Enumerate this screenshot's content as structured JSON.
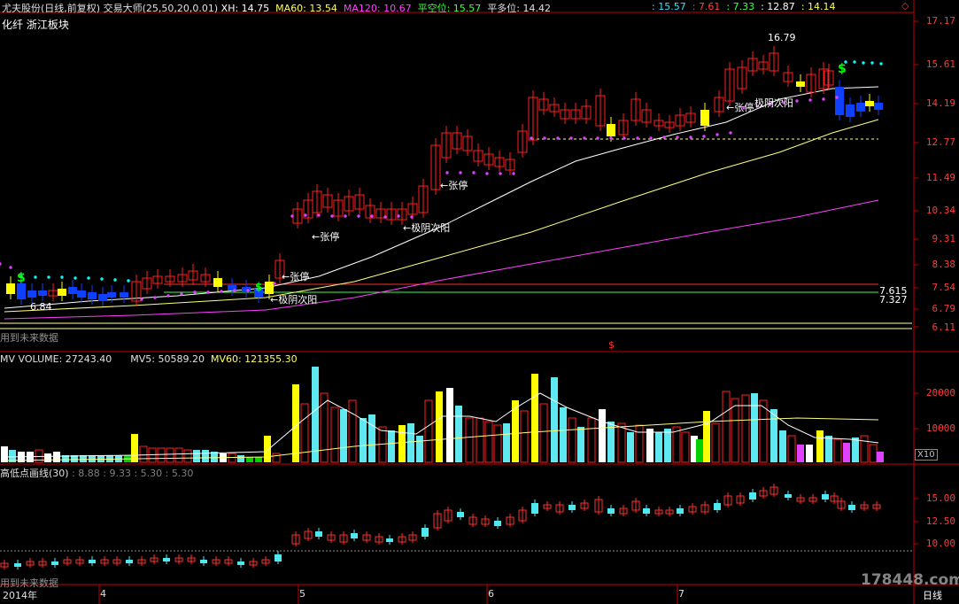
{
  "header": {
    "title": "尤夫股份(日线,前复权)",
    "indicator_name": "交易大师(25,50,20,0.01)",
    "xh": "XH: 14.75",
    "ma60": "MA60: 13.54",
    "ma120": "MA120: 10.67",
    "pingkong": "平空位: 15.57",
    "pingduo": "平多位: 14.42",
    "right_values": [
      ": 15.57",
      ": 7.61",
      ": 7.33",
      ": 12.87",
      ": 14.14"
    ],
    "sector": "化纤 浙江板块"
  },
  "main": {
    "y_labels": [
      "17.17",
      "15.61",
      "14.19",
      "12.77",
      "11.49",
      "10.34",
      "9.31",
      "8.38",
      "7.54",
      "6.79",
      "6.11"
    ],
    "annotations": {
      "high": "16.79",
      "low": "6.84",
      "zt1": "←张停",
      "zt2": "←张停",
      "zt3": "←张停",
      "zt4": "←张停",
      "jy1": "←极阴次阳",
      "jy2": "←极阴次阳",
      "jy3": "极阴次阳",
      "level1": "7.615",
      "level2": "7.327",
      "future": "用到未来数据",
      "dollar": "$"
    }
  },
  "volume": {
    "header": "MV VOLUME: 27243.40",
    "mv5": "MV5: 50589.20",
    "mv60": "MV60: 121355.30",
    "y_labels": [
      "20000",
      "10000"
    ],
    "unit": "X10"
  },
  "hl": {
    "header": "高低点画线(30)",
    "values": ": 8.88 : 9.33 : 5.30 : 5.30",
    "y_labels": [
      "15.00",
      "12.50",
      "10.00"
    ],
    "future": "用到未来数据"
  },
  "dates": [
    "2014年",
    "4",
    "5",
    "6",
    "7"
  ],
  "bottom_right": "日线",
  "watermark": "178448.com",
  "colors": {
    "up": "#ff3030",
    "down": "#50e8f0",
    "cyan": "#00ffff",
    "yellow": "#ffff00",
    "magenta": "#ff40ff",
    "axis": "#c00000"
  }
}
